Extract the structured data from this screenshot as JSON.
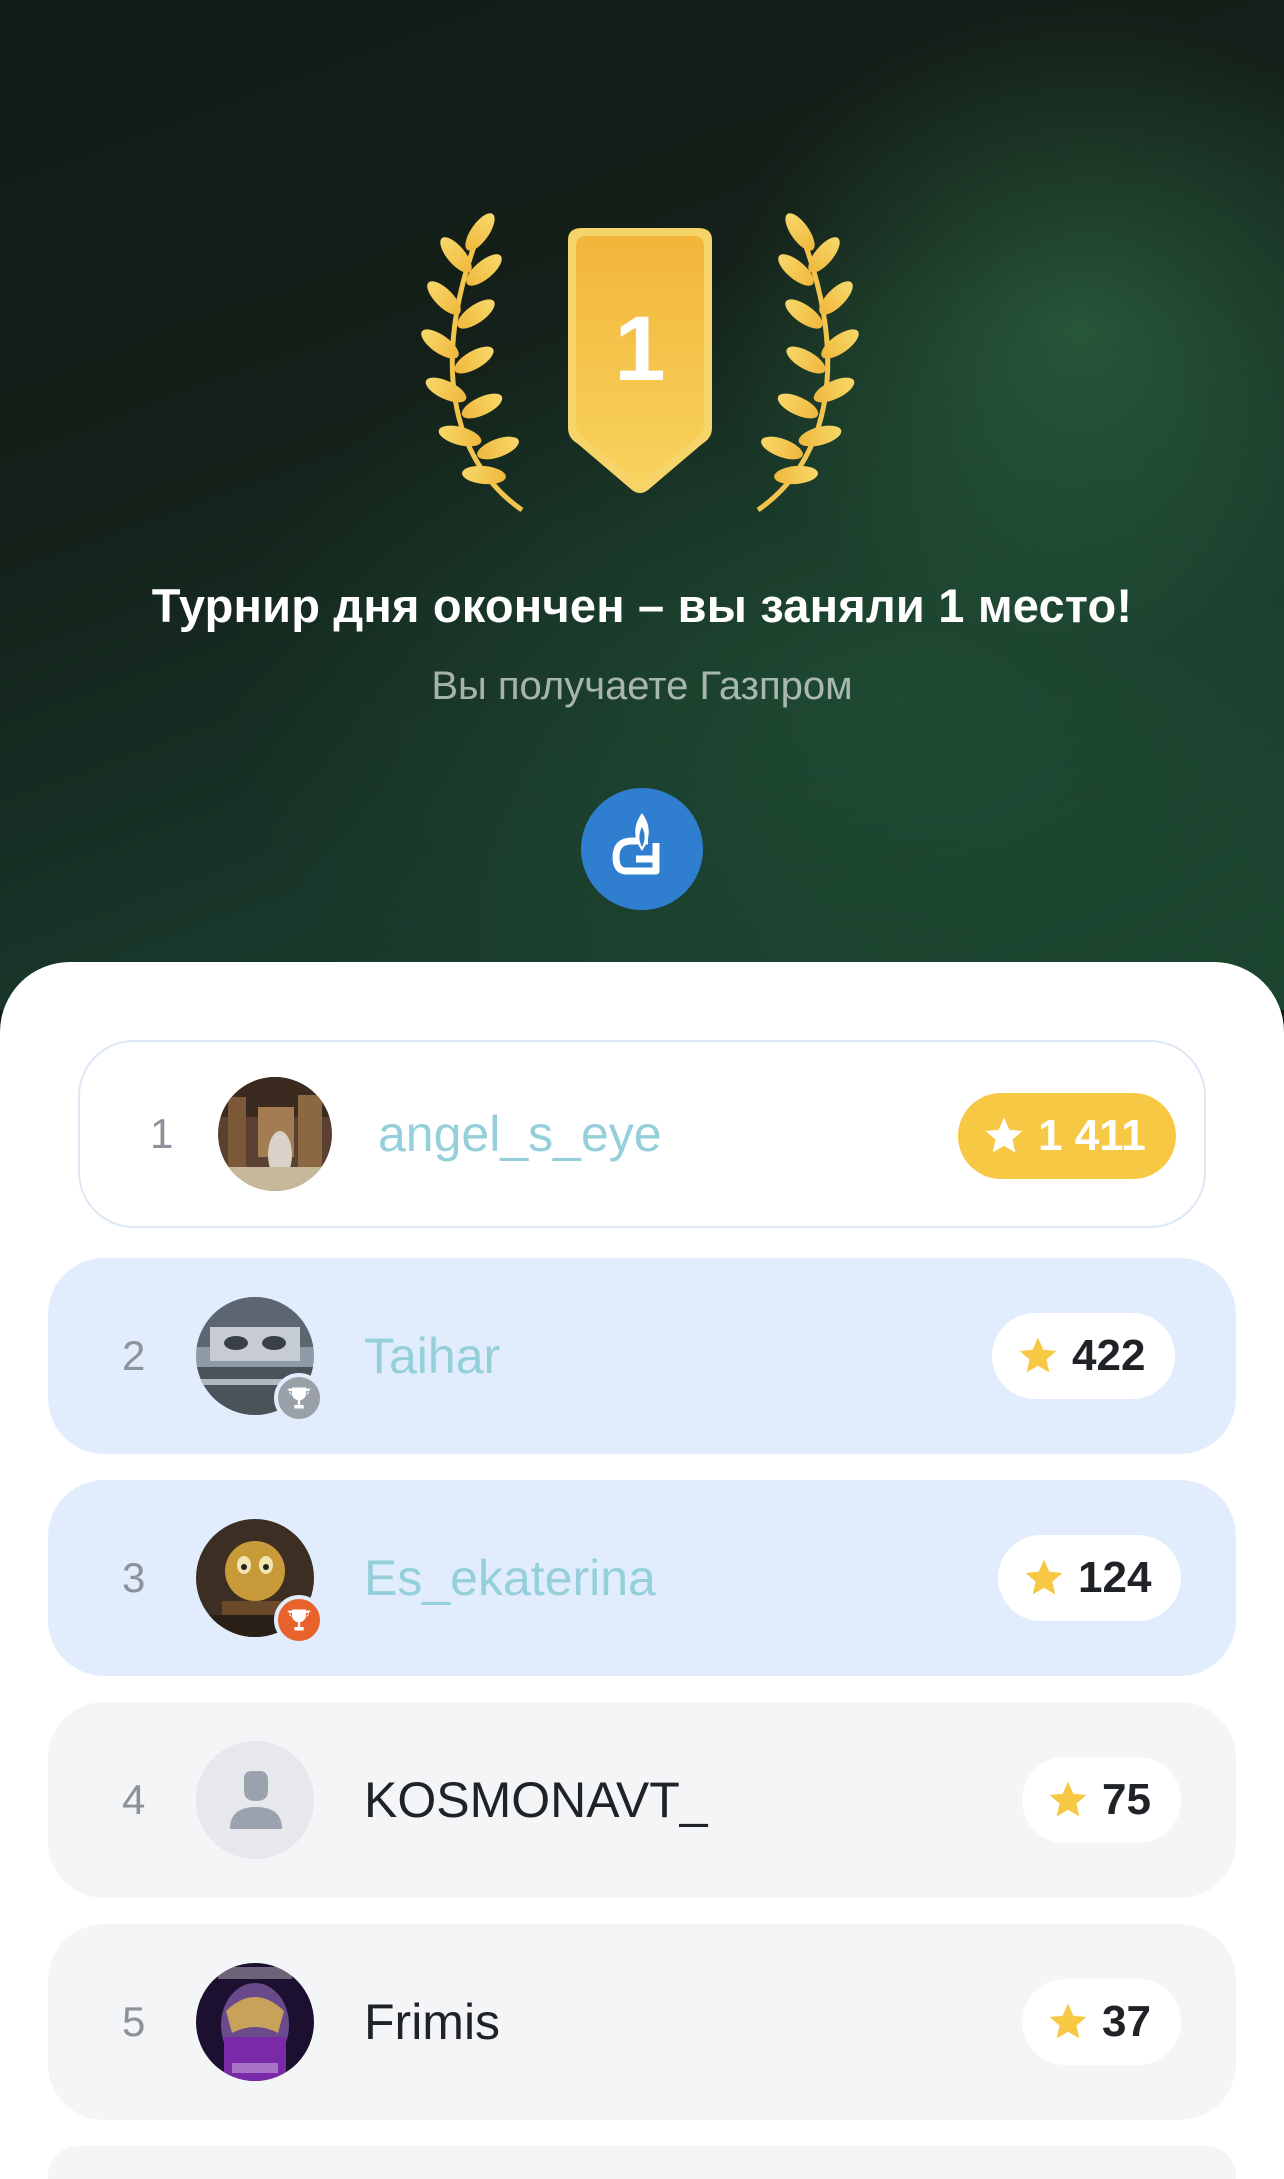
{
  "result": {
    "place_number": "1",
    "title": "Турнир дня окончен – вы заняли 1 место!",
    "subtitle": "Вы получаете Газпром"
  },
  "prize": {
    "name": "Газпром",
    "icon": "gazprom-logo-icon",
    "color": "#2f7ed0"
  },
  "leaderboard": [
    {
      "rank": "1",
      "name": "angel_s_eye",
      "score": "1 411",
      "current_user": true
    },
    {
      "rank": "2",
      "name": "Taihar",
      "score": "422",
      "badge": "silver-trophy-icon"
    },
    {
      "rank": "3",
      "name": "Es_ekaterina",
      "score": "124",
      "badge": "bronze-trophy-icon"
    },
    {
      "rank": "4",
      "name": "KOSMONAVT_",
      "score": "75",
      "avatar": "default-user-icon"
    },
    {
      "rank": "5",
      "name": "Frimis",
      "score": "37"
    }
  ],
  "colors": {
    "gold": "#f6c844",
    "highlight_row": "#e1edfc",
    "row": "#f4f5f7",
    "link_name": "#95d0da",
    "silver_badge": "#9aa0a8",
    "bronze_badge": "#e8622c"
  }
}
